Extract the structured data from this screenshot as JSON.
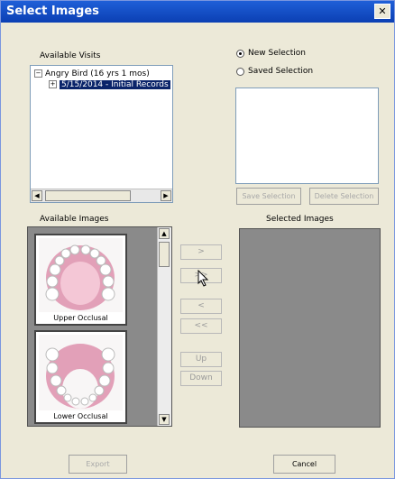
{
  "window": {
    "title": "Select Images",
    "close_glyph": "✕"
  },
  "visits": {
    "label": "Available Visits",
    "root": {
      "toggle": "−",
      "label": "Angry Bird (16 yrs 1 mos)"
    },
    "child": {
      "toggle": "+",
      "label": "5/15/2014 - Initial Records"
    }
  },
  "selection": {
    "new_label": "New Selection",
    "saved_label": "Saved Selection",
    "selected": "new",
    "save_button": "Save Selection",
    "delete_button": "Delete Selection"
  },
  "images": {
    "label": "Available Images",
    "items": [
      {
        "caption": "Upper Occlusal"
      },
      {
        "caption": "Lower Occlusal"
      }
    ]
  },
  "selected_images": {
    "label": "Selected Images"
  },
  "transfer": {
    "add": ">",
    "add_all": ">>",
    "remove": "<",
    "remove_all": "<<",
    "up": "Up",
    "down": "Down"
  },
  "footer": {
    "export": "Export",
    "cancel": "Cancel"
  },
  "colors": {
    "titlebar": "#0b3fb3",
    "selection_highlight": "#0a246a",
    "image_panel": "#8a8a8a",
    "gum": "#e2a0b8",
    "tooth": "#ffffff"
  }
}
